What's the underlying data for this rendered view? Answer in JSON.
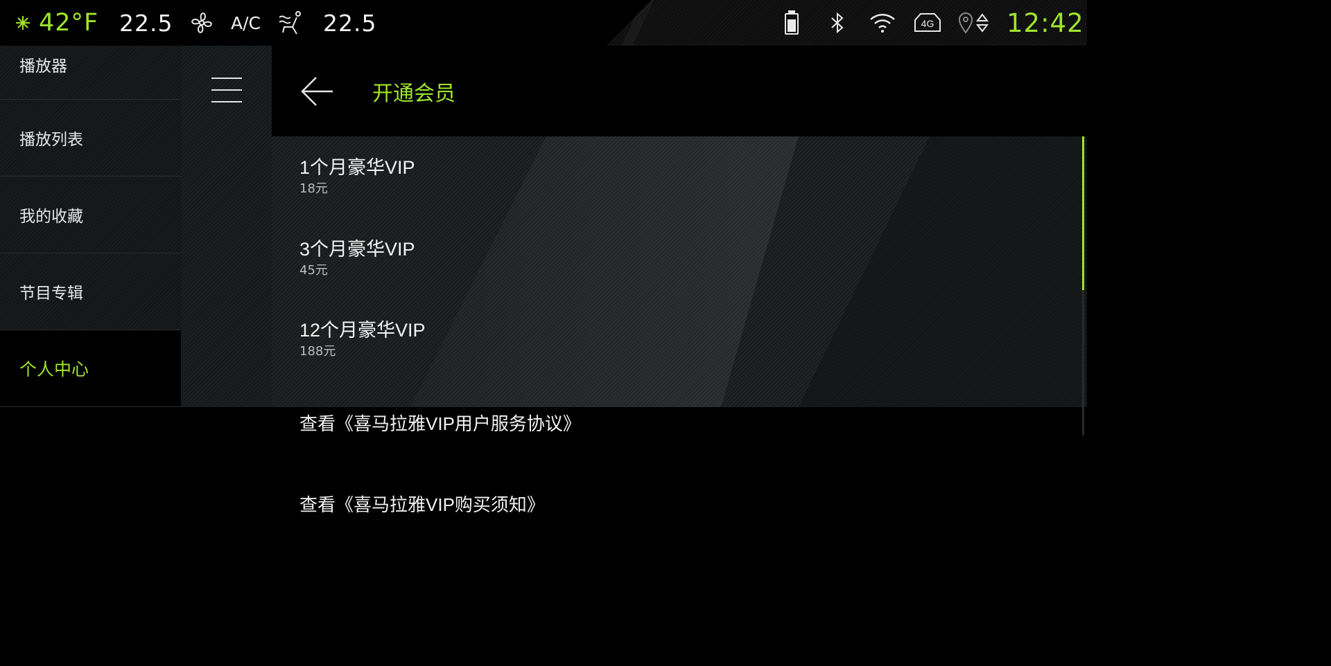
{
  "statusbar": {
    "outside_temp": "42°F",
    "left_temp": "22.5",
    "ac_label": "A/C",
    "right_temp": "22.5",
    "clock": "12:42",
    "network_label": "4G",
    "icons": [
      "snowflake-icon",
      "fan-icon",
      "seat-airflow-icon",
      "battery-icon",
      "bluetooth-icon",
      "wifi-icon",
      "4g-network-icon",
      "location-icon",
      "sort-arrows-icon"
    ]
  },
  "sidebar": {
    "items": [
      {
        "label": "播放器",
        "active": false
      },
      {
        "label": "播放列表",
        "active": false
      },
      {
        "label": "我的收藏",
        "active": false
      },
      {
        "label": "节目专辑",
        "active": false
      },
      {
        "label": "个人中心",
        "active": true
      }
    ]
  },
  "header": {
    "title": "开通会员",
    "icons": [
      "menu-icon",
      "back-arrow-icon"
    ]
  },
  "vip_plans": [
    {
      "name": "1个月豪华VIP",
      "price": "18元"
    },
    {
      "name": "3个月豪华VIP",
      "price": "45元"
    },
    {
      "name": "12个月豪华VIP",
      "price": "188元"
    }
  ],
  "links": {
    "agreement": "查看《喜马拉雅VIP用户服务协议》",
    "purchase_notice": "查看《喜马拉雅VIP购买须知》"
  },
  "colors": {
    "accent": "#9ee52b",
    "background": "#000000",
    "text": "#f2f2f2"
  }
}
